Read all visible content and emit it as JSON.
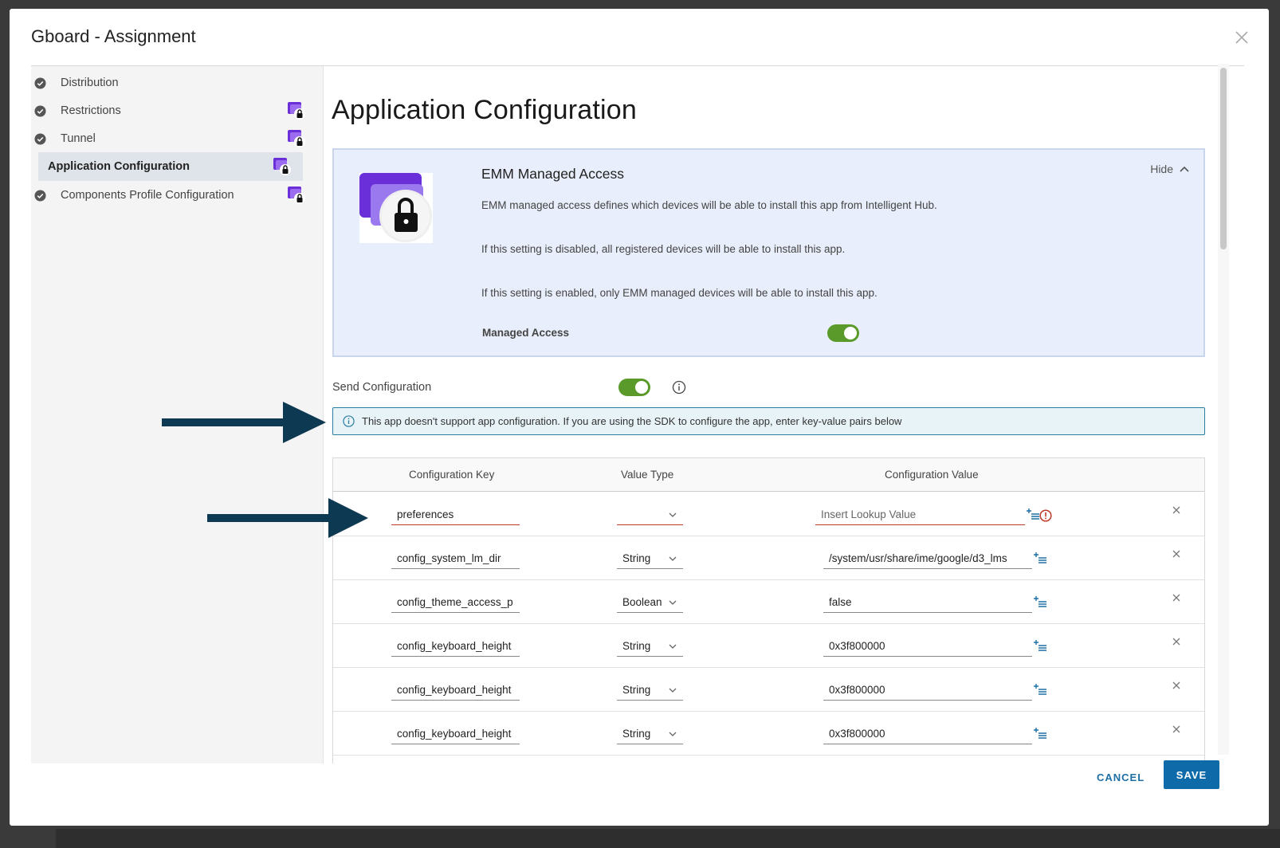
{
  "modal": {
    "title": "Gboard - Assignment"
  },
  "sidebar": {
    "items": [
      {
        "label": "Distribution",
        "completed": true,
        "locked": false
      },
      {
        "label": "Restrictions",
        "completed": true,
        "locked": true
      },
      {
        "label": "Tunnel",
        "completed": true,
        "locked": true
      },
      {
        "label": "Application Configuration",
        "completed": false,
        "locked": true,
        "active": true
      },
      {
        "label": "Components Profile Configuration",
        "completed": true,
        "locked": true
      }
    ]
  },
  "main": {
    "title": "Application Configuration",
    "emm": {
      "title": "EMM Managed Access",
      "hide_label": "Hide",
      "lines": [
        "EMM managed access defines which devices will be able to install this app from Intelligent Hub.",
        "If this setting is disabled, all registered devices will be able to install this app.",
        "If this setting is enabled, only EMM managed devices will be able to install this app."
      ],
      "managed_access_label": "Managed Access",
      "managed_access_on": true
    },
    "send_configuration": {
      "label": "Send Configuration",
      "on": true
    },
    "notice": "This app doesn't support app configuration. If you are using the SDK to configure the app, enter key-value pairs below",
    "table": {
      "headers": [
        "Configuration Key",
        "Value Type",
        "Configuration Value"
      ],
      "rows": [
        {
          "key": "preferences",
          "type": "",
          "value": "Insert Lookup Value",
          "value_is_placeholder": true,
          "error": true
        },
        {
          "key": "config_system_lm_dir",
          "type": "String",
          "value": "/system/usr/share/ime/google/d3_lms",
          "error": false
        },
        {
          "key": "config_theme_access_p",
          "type": "Boolean",
          "value": "false",
          "error": false
        },
        {
          "key": "config_keyboard_height",
          "type": "String",
          "value": "0x3f800000",
          "error": false
        },
        {
          "key": "config_keyboard_height",
          "type": "String",
          "value": "0x3f800000",
          "error": false
        },
        {
          "key": "config_keyboard_height",
          "type": "String",
          "value": "0x3f800000",
          "error": false
        }
      ]
    }
  },
  "footer": {
    "cancel_label": "CANCEL",
    "save_label": "SAVE"
  },
  "colors": {
    "accent": "#0e6aa8",
    "toggle_on": "#5a9a2a",
    "error": "#c0392b",
    "arrow": "#0d3a52",
    "lock_badge": "#6a2fd9"
  }
}
